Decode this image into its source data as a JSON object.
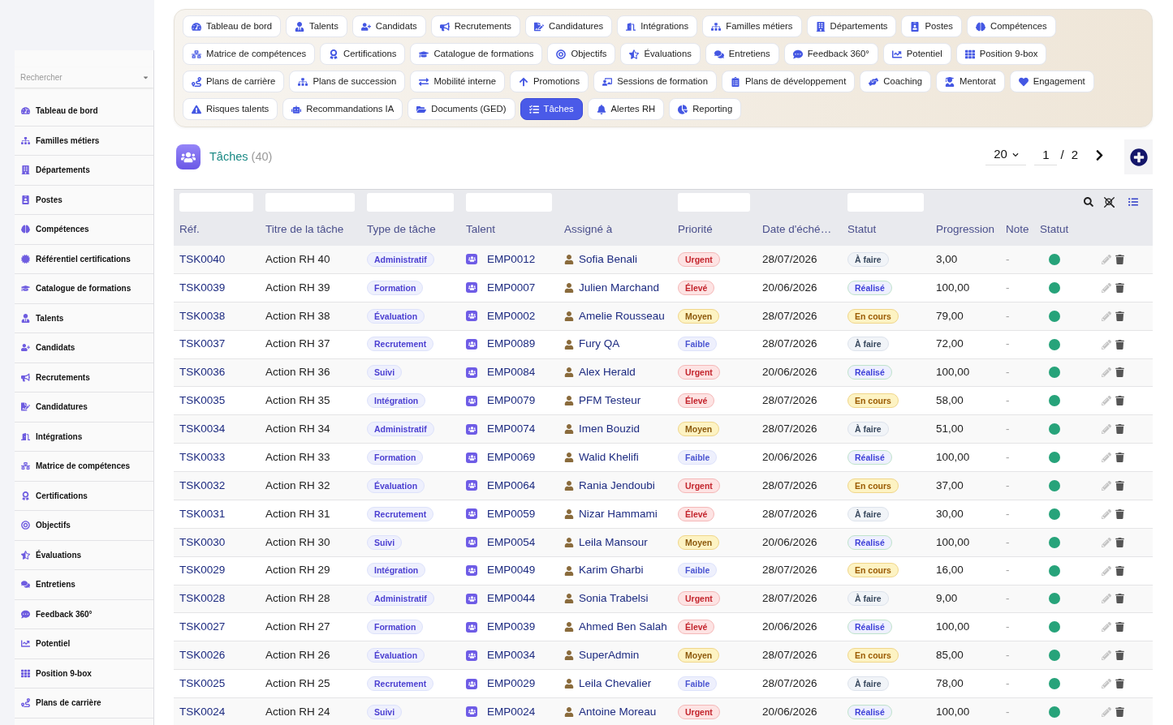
{
  "sidebar": {
    "search": {
      "placeholder": "Rechercher"
    },
    "items": [
      {
        "label": "Tableau de bord",
        "selected": false
      },
      {
        "label": "Familles métiers",
        "selected": false
      },
      {
        "label": "Départements",
        "selected": false
      },
      {
        "label": "Postes",
        "selected": false
      },
      {
        "label": "Compétences",
        "selected": false
      },
      {
        "label": "Référentiel certifications",
        "selected": false
      },
      {
        "label": "Catalogue de formations",
        "selected": false
      },
      {
        "label": "Talents",
        "selected": false
      },
      {
        "label": "Candidats",
        "selected": false
      },
      {
        "label": "Recrutements",
        "selected": false
      },
      {
        "label": "Candidatures",
        "selected": false
      },
      {
        "label": "Intégrations",
        "selected": false
      },
      {
        "label": "Matrice de compétences",
        "selected": false
      },
      {
        "label": "Certifications",
        "selected": false
      },
      {
        "label": "Objectifs",
        "selected": false
      },
      {
        "label": "Évaluations",
        "selected": false
      },
      {
        "label": "Entretiens",
        "selected": false
      },
      {
        "label": "Feedback 360°",
        "selected": false
      },
      {
        "label": "Potentiel",
        "selected": false
      },
      {
        "label": "Position 9-box",
        "selected": false
      },
      {
        "label": "Plans de carrière",
        "selected": false
      }
    ]
  },
  "nav": {
    "tabs": [
      {
        "label": "Tableau de bord",
        "selected": false
      },
      {
        "label": "Talents",
        "selected": false
      },
      {
        "label": "Candidats",
        "selected": false
      },
      {
        "label": "Recrutements",
        "selected": false
      },
      {
        "label": "Candidatures",
        "selected": false
      },
      {
        "label": "Intégrations",
        "selected": false
      },
      {
        "label": "Familles métiers",
        "selected": false
      },
      {
        "label": "Départements",
        "selected": false
      },
      {
        "label": "Postes",
        "selected": false
      },
      {
        "label": "Compétences",
        "selected": false
      },
      {
        "label": "Matrice de compétences",
        "selected": false
      },
      {
        "label": "Certifications",
        "selected": false
      },
      {
        "label": "Catalogue de formations",
        "selected": false
      },
      {
        "label": "Objectifs",
        "selected": false
      },
      {
        "label": "Évaluations",
        "selected": false
      },
      {
        "label": "Entretiens",
        "selected": false
      },
      {
        "label": "Feedback 360°",
        "selected": false
      },
      {
        "label": "Potentiel",
        "selected": false
      },
      {
        "label": "Position 9-box",
        "selected": false
      },
      {
        "label": "Plans de carrière",
        "selected": false
      },
      {
        "label": "Plans de succession",
        "selected": false
      },
      {
        "label": "Mobilité interne",
        "selected": false
      },
      {
        "label": "Promotions",
        "selected": false
      },
      {
        "label": "Sessions de formation",
        "selected": false
      },
      {
        "label": "Plans de développement",
        "selected": false
      },
      {
        "label": "Coaching",
        "selected": false
      },
      {
        "label": "Mentorat",
        "selected": false
      },
      {
        "label": "Engagement",
        "selected": false
      },
      {
        "label": "Risques talents",
        "selected": false
      },
      {
        "label": "Recommandations IA",
        "selected": false
      },
      {
        "label": "Documents (GED)",
        "selected": false
      },
      {
        "label": "Tâches",
        "selected": true
      },
      {
        "label": "Alertes RH",
        "selected": false
      },
      {
        "label": "Reporting",
        "selected": false
      }
    ]
  },
  "header": {
    "title": "Tâches",
    "count": "(40)"
  },
  "pagination": {
    "page_size": "20",
    "page": "1",
    "separator": "/",
    "total_pages": "2"
  },
  "table": {
    "columns": [
      {
        "label": "Réf.",
        "filter": true
      },
      {
        "label": "Titre de la tâche",
        "filter": true
      },
      {
        "label": "Type de tâche",
        "filter": true
      },
      {
        "label": "Talent",
        "filter": true
      },
      {
        "label": "Assigné à",
        "filter": false
      },
      {
        "label": "Priorité",
        "filter": true
      },
      {
        "label": "Date d'éché…",
        "filter": false
      },
      {
        "label": "Statut",
        "filter": true
      },
      {
        "label": "Progression",
        "filter": false
      },
      {
        "label": "Note",
        "filter": false
      },
      {
        "label": "Statut",
        "filter": false
      }
    ],
    "rows": [
      {
        "ref": "TSK0040",
        "title": "Action RH 40",
        "type": "Administratif",
        "talent": "EMP0012",
        "assignee": "Sofia Benali",
        "priority": {
          "label": "Urgent",
          "kind": "urgent"
        },
        "due_date": "28/07/2026",
        "status": {
          "label": "À faire",
          "kind": "todo"
        },
        "progress": "3,00",
        "note": "-",
        "active": true
      },
      {
        "ref": "TSK0039",
        "title": "Action RH 39",
        "type": "Formation",
        "talent": "EMP0007",
        "assignee": "Julien Marchand",
        "priority": {
          "label": "Élevé",
          "kind": "high"
        },
        "due_date": "20/06/2026",
        "status": {
          "label": "Réalisé",
          "kind": "done"
        },
        "progress": "100,00",
        "note": "-",
        "active": true
      },
      {
        "ref": "TSK0038",
        "title": "Action RH 38",
        "type": "Évaluation",
        "talent": "EMP0002",
        "assignee": "Amelie Rousseau",
        "priority": {
          "label": "Moyen",
          "kind": "medium"
        },
        "due_date": "28/07/2026",
        "status": {
          "label": "En cours",
          "kind": "in_progress"
        },
        "progress": "79,00",
        "note": "-",
        "active": true
      },
      {
        "ref": "TSK0037",
        "title": "Action RH 37",
        "type": "Recrutement",
        "talent": "EMP0089",
        "assignee": "Fury QA",
        "priority": {
          "label": "Faible",
          "kind": "low"
        },
        "due_date": "28/07/2026",
        "status": {
          "label": "À faire",
          "kind": "todo"
        },
        "progress": "72,00",
        "note": "-",
        "active": true
      },
      {
        "ref": "TSK0036",
        "title": "Action RH 36",
        "type": "Suivi",
        "talent": "EMP0084",
        "assignee": "Alex Herald",
        "priority": {
          "label": "Urgent",
          "kind": "urgent"
        },
        "due_date": "20/06/2026",
        "status": {
          "label": "Réalisé",
          "kind": "done"
        },
        "progress": "100,00",
        "note": "-",
        "active": true
      },
      {
        "ref": "TSK0035",
        "title": "Action RH 35",
        "type": "Intégration",
        "talent": "EMP0079",
        "assignee": "PFM Testeur",
        "priority": {
          "label": "Élevé",
          "kind": "high"
        },
        "due_date": "28/07/2026",
        "status": {
          "label": "En cours",
          "kind": "in_progress"
        },
        "progress": "58,00",
        "note": "-",
        "active": true
      },
      {
        "ref": "TSK0034",
        "title": "Action RH 34",
        "type": "Administratif",
        "talent": "EMP0074",
        "assignee": "Imen Bouzid",
        "priority": {
          "label": "Moyen",
          "kind": "medium"
        },
        "due_date": "28/07/2026",
        "status": {
          "label": "À faire",
          "kind": "todo"
        },
        "progress": "51,00",
        "note": "-",
        "active": true
      },
      {
        "ref": "TSK0033",
        "title": "Action RH 33",
        "type": "Formation",
        "talent": "EMP0069",
        "assignee": "Walid Khelifi",
        "priority": {
          "label": "Faible",
          "kind": "low"
        },
        "due_date": "20/06/2026",
        "status": {
          "label": "Réalisé",
          "kind": "done"
        },
        "progress": "100,00",
        "note": "-",
        "active": true
      },
      {
        "ref": "TSK0032",
        "title": "Action RH 32",
        "type": "Évaluation",
        "talent": "EMP0064",
        "assignee": "Rania Jendoubi",
        "priority": {
          "label": "Urgent",
          "kind": "urgent"
        },
        "due_date": "28/07/2026",
        "status": {
          "label": "En cours",
          "kind": "in_progress"
        },
        "progress": "37,00",
        "note": "-",
        "active": true
      },
      {
        "ref": "TSK0031",
        "title": "Action RH 31",
        "type": "Recrutement",
        "talent": "EMP0059",
        "assignee": "Nizar Hammami",
        "priority": {
          "label": "Élevé",
          "kind": "high"
        },
        "due_date": "28/07/2026",
        "status": {
          "label": "À faire",
          "kind": "todo"
        },
        "progress": "30,00",
        "note": "-",
        "active": true
      },
      {
        "ref": "TSK0030",
        "title": "Action RH 30",
        "type": "Suivi",
        "talent": "EMP0054",
        "assignee": "Leila Mansour",
        "priority": {
          "label": "Moyen",
          "kind": "medium"
        },
        "due_date": "20/06/2026",
        "status": {
          "label": "Réalisé",
          "kind": "done"
        },
        "progress": "100,00",
        "note": "-",
        "active": true
      },
      {
        "ref": "TSK0029",
        "title": "Action RH 29",
        "type": "Intégration",
        "talent": "EMP0049",
        "assignee": "Karim Gharbi",
        "priority": {
          "label": "Faible",
          "kind": "low"
        },
        "due_date": "28/07/2026",
        "status": {
          "label": "En cours",
          "kind": "in_progress"
        },
        "progress": "16,00",
        "note": "-",
        "active": true
      },
      {
        "ref": "TSK0028",
        "title": "Action RH 28",
        "type": "Administratif",
        "talent": "EMP0044",
        "assignee": "Sonia Trabelsi",
        "priority": {
          "label": "Urgent",
          "kind": "urgent"
        },
        "due_date": "28/07/2026",
        "status": {
          "label": "À faire",
          "kind": "todo"
        },
        "progress": "9,00",
        "note": "-",
        "active": true
      },
      {
        "ref": "TSK0027",
        "title": "Action RH 27",
        "type": "Formation",
        "talent": "EMP0039",
        "assignee": "Ahmed Ben Salah",
        "priority": {
          "label": "Élevé",
          "kind": "high"
        },
        "due_date": "20/06/2026",
        "status": {
          "label": "Réalisé",
          "kind": "done"
        },
        "progress": "100,00",
        "note": "-",
        "active": true
      },
      {
        "ref": "TSK0026",
        "title": "Action RH 26",
        "type": "Évaluation",
        "talent": "EMP0034",
        "assignee": "SuperAdmin",
        "priority": {
          "label": "Moyen",
          "kind": "medium"
        },
        "due_date": "28/07/2026",
        "status": {
          "label": "En cours",
          "kind": "in_progress"
        },
        "progress": "85,00",
        "note": "-",
        "active": true
      },
      {
        "ref": "TSK0025",
        "title": "Action RH 25",
        "type": "Recrutement",
        "talent": "EMP0029",
        "assignee": "Leila Chevalier",
        "priority": {
          "label": "Faible",
          "kind": "low"
        },
        "due_date": "28/07/2026",
        "status": {
          "label": "À faire",
          "kind": "todo"
        },
        "progress": "78,00",
        "note": "-",
        "active": true
      },
      {
        "ref": "TSK0024",
        "title": "Action RH 24",
        "type": "Suivi",
        "talent": "EMP0024",
        "assignee": "Antoine Moreau",
        "priority": {
          "label": "Urgent",
          "kind": "urgent"
        },
        "due_date": "20/06/2026",
        "status": {
          "label": "Réalisé",
          "kind": "done"
        },
        "progress": "100,00",
        "note": "-",
        "active": true
      }
    ]
  }
}
